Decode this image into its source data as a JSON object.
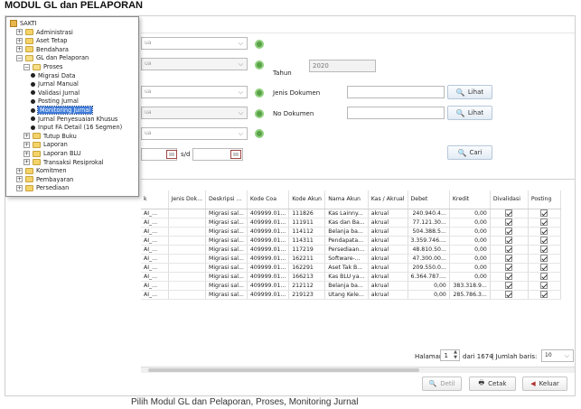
{
  "doc_title": "MODUL GL dan PELAPORAN",
  "caption": "Pilih Modul GL dan Pelaporan, Proses, Monitoring Jurnal",
  "tree": [
    {
      "label": "SAKTI",
      "level": 0
    },
    {
      "label": "Administrasi",
      "level": 1
    },
    {
      "label": "Aset Tetap",
      "level": 1
    },
    {
      "label": "Bendahara",
      "level": 1
    },
    {
      "label": "GL dan Pelaporan",
      "level": 1
    },
    {
      "label": "Proses",
      "level": 2
    },
    {
      "label": "Migrasi Data",
      "level": 3
    },
    {
      "label": "Jurnal Manual",
      "level": 3
    },
    {
      "label": "Validasi Jurnal",
      "level": 3
    },
    {
      "label": "Posting Jurnal",
      "level": 3
    },
    {
      "label": "Monitoring Jurnal",
      "level": 3
    },
    {
      "label": "Jurnal Penyesuaian Khusus",
      "level": 3
    },
    {
      "label": "Input FA Detail (16 Segmen)",
      "level": 3
    },
    {
      "label": "Tutup Buku",
      "level": 2
    },
    {
      "label": "Laporan",
      "level": 2
    },
    {
      "label": "Laporan BLU",
      "level": 2
    },
    {
      "label": "Transaksi Resiprokal",
      "level": 2
    },
    {
      "label": "Komitmen",
      "level": 1
    },
    {
      "label": "Pembayaran",
      "level": 1
    },
    {
      "label": "Persediaan",
      "level": 1
    }
  ],
  "filters": {
    "combo_partial": "ua",
    "tahun_label": "Tahun",
    "tahun_value": "2020",
    "jenis_dokumen_label": "Jenis Dokumen",
    "no_dokumen_label": "No Dokumen",
    "lihat_label": "Lihat",
    "sd_label": "s/d",
    "cari_label": "Cari"
  },
  "table": {
    "columns": [
      "k",
      "Jenis Dok...",
      "Deskripsi ...",
      "Kode Coa",
      "Kode Akun",
      "Nama Akun",
      "Kas / Akrual",
      "Debet",
      "Kredit",
      "Divalidasi",
      "Posting"
    ],
    "rows": [
      [
        "AI_...",
        "",
        "Migrasi sal...",
        "409999.01...",
        "111826",
        "Kas Lainny...",
        "akrual",
        "240.940.4...",
        "0,00",
        true,
        true
      ],
      [
        "AI_...",
        "",
        "Migrasi sal...",
        "409999.01...",
        "111911",
        "Kas dan Ba...",
        "akrual",
        "77.121.30...",
        "0,00",
        true,
        true
      ],
      [
        "AI_...",
        "",
        "Migrasi sal...",
        "409999.01...",
        "114112",
        "Belanja ba...",
        "akrual",
        "504.388.5...",
        "0,00",
        true,
        true
      ],
      [
        "AI_...",
        "",
        "Migrasi sal...",
        "409999.01...",
        "114311",
        "Pendapata...",
        "akrual",
        "3.359.746....",
        "0,00",
        true,
        true
      ],
      [
        "AI_...",
        "",
        "Migrasi sal...",
        "409999.01...",
        "117219",
        "Persediaan...",
        "akrual",
        "48.810.50...",
        "0,00",
        true,
        true
      ],
      [
        "AI_...",
        "",
        "Migrasi sal...",
        "409999.01...",
        "162211",
        "Software-...",
        "akrual",
        "47.300.00...",
        "0,00",
        true,
        true
      ],
      [
        "AI_...",
        "",
        "Migrasi sal...",
        "409999.01...",
        "162291",
        "Aset Tak B...",
        "akrual",
        "209.550.0...",
        "0,00",
        true,
        true
      ],
      [
        "AI_...",
        "",
        "Migrasi sal...",
        "409999.01...",
        "166213",
        "Kas BLU ya...",
        "akrual",
        "6.364.787....",
        "0,00",
        true,
        true
      ],
      [
        "AI_...",
        "",
        "Migrasi sal...",
        "409999.01...",
        "212112",
        "Belanja ba...",
        "akrual",
        "0,00",
        "383.318.9...",
        true,
        true
      ],
      [
        "AI_...",
        "",
        "Migrasi sal...",
        "409999.01...",
        "219123",
        "Utang Kele...",
        "akrual",
        "0,00",
        "285.786.3...",
        true,
        true
      ]
    ]
  },
  "pager": {
    "halaman_label": "Halaman",
    "page_value": "1",
    "dari_label": "dari 1674",
    "jumlah_label": "| Jumlah baris:",
    "rows_value": "10"
  },
  "buttons": {
    "detil": "Detil",
    "cetak": "Cetak",
    "keluar": "Keluar"
  }
}
